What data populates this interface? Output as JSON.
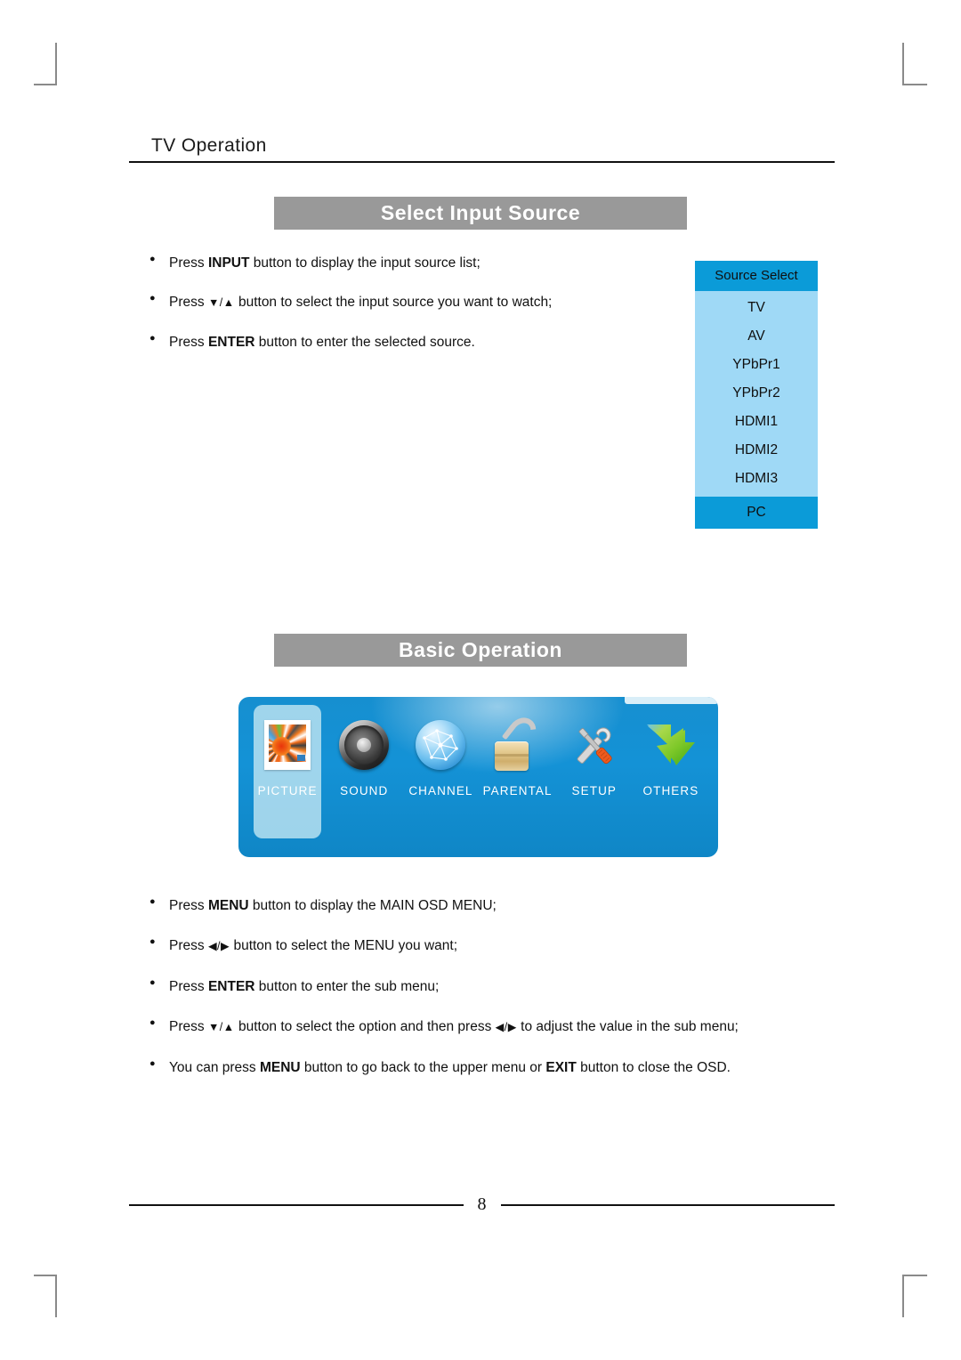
{
  "page": {
    "header_title": "TV  Operation",
    "page_number": "8"
  },
  "sections": {
    "select_input_source": {
      "bar_label": "Select Input Source",
      "bullets": [
        {
          "parts": [
            {
              "t": "Press ",
              "b": false
            },
            {
              "t": "INPUT",
              "b": true
            },
            {
              "t": " button to display the  input source list;",
              "b": false
            }
          ]
        },
        {
          "parts": [
            {
              "t": "Press ",
              "b": false
            },
            {
              "t": "▼/▲",
              "b": false,
              "arrow": true
            },
            {
              "t": " button to select the input source you want to watch;",
              "b": false
            }
          ]
        },
        {
          "parts": [
            {
              "t": "Press ",
              "b": false
            },
            {
              "t": "ENTER",
              "b": true
            },
            {
              "t": " button to enter the selected source.",
              "b": false
            }
          ]
        }
      ]
    },
    "basic_operation": {
      "bar_label": "Basic Operation",
      "bullets": [
        {
          "parts": [
            {
              "t": "Press ",
              "b": false
            },
            {
              "t": "MENU",
              "b": true
            },
            {
              "t": " button to display the MAIN OSD MENU;",
              "b": false
            }
          ]
        },
        {
          "parts": [
            {
              "t": "Press ",
              "b": false
            },
            {
              "t": "◀/▶",
              "b": false,
              "arrow": true
            },
            {
              "t": " button to select the MENU you want;",
              "b": false
            }
          ]
        },
        {
          "parts": [
            {
              "t": "Press ",
              "b": false
            },
            {
              "t": "ENTER",
              "b": true
            },
            {
              "t": " button to enter the sub menu;",
              "b": false
            }
          ]
        },
        {
          "parts": [
            {
              "t": "Press ",
              "b": false
            },
            {
              "t": "▼/▲",
              "b": false,
              "arrow": true
            },
            {
              "t": " button to select the option and then press  ",
              "b": false
            },
            {
              "t": "◀/▶",
              "b": false,
              "arrow": true
            },
            {
              "t": " to adjust the value in the sub menu;",
              "b": false
            }
          ]
        },
        {
          "parts": [
            {
              "t": "You can press ",
              "b": false
            },
            {
              "t": "MENU",
              "b": true
            },
            {
              "t": " button to go back to the upper menu or ",
              "b": false
            },
            {
              "t": "EXIT",
              "b": true
            },
            {
              "t": " button to close the OSD.",
              "b": false
            }
          ]
        }
      ]
    }
  },
  "source_select": {
    "title": "Source Select",
    "items": [
      {
        "label": "TV",
        "selected": false
      },
      {
        "label": "AV",
        "selected": false
      },
      {
        "label": "YPbPr1",
        "selected": false
      },
      {
        "label": "YPbPr2",
        "selected": false
      },
      {
        "label": "HDMI1",
        "selected": false
      },
      {
        "label": "HDMI2",
        "selected": false
      },
      {
        "label": "HDMI3",
        "selected": false
      },
      {
        "label": "PC",
        "selected": true
      }
    ],
    "colors": {
      "header": "#0b9bd8",
      "body": "#9fd9f6",
      "selected": "#0b9bd8"
    }
  },
  "osd_main_menu": {
    "items": [
      {
        "label": "PICTURE",
        "icon": "picture-thumbnail-icon",
        "active": true
      },
      {
        "label": "SOUND",
        "icon": "speaker-icon",
        "active": false
      },
      {
        "label": "CHANNEL",
        "icon": "globe-network-icon",
        "active": false
      },
      {
        "label": "PARENTAL",
        "icon": "padlock-open-icon",
        "active": false
      },
      {
        "label": "SETUP",
        "icon": "wrench-screwdriver-icon",
        "active": false
      },
      {
        "label": "OTHERS",
        "icon": "green-arrow-icon",
        "active": false
      }
    ],
    "colors": {
      "panel": "#1492d6",
      "highlight": "#bee4f2",
      "label": "#ffffff"
    }
  }
}
